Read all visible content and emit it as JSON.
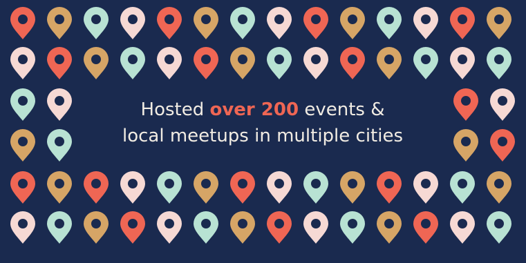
{
  "palette": {
    "background": "#1a2a4f",
    "coral": "#ef6654",
    "tan": "#d6a566",
    "mint": "#b8e2d3",
    "blush": "#f6d9d4",
    "text": "#f1ece3"
  },
  "icon": "map-pin-icon",
  "headline": {
    "prefix": "Hosted ",
    "highlight": "over 200",
    "suffix_line1": " events &",
    "line2": "local meetups in multiple cities"
  },
  "pin_rows": [
    [
      "coral",
      "tan",
      "mint",
      "blush",
      "coral",
      "tan",
      "mint",
      "blush",
      "coral",
      "tan",
      "mint",
      "blush",
      "coral",
      "tan"
    ],
    [
      "blush",
      "coral",
      "tan",
      "mint",
      "blush",
      "coral",
      "tan",
      "mint",
      "blush",
      "coral",
      "tan",
      "mint",
      "blush",
      "mint"
    ],
    [
      "mint",
      "blush",
      "coral",
      "blush"
    ],
    [
      "tan",
      "mint",
      "tan",
      "coral"
    ],
    [
      "coral",
      "tan",
      "coral",
      "blush",
      "mint",
      "tan",
      "coral",
      "blush",
      "mint",
      "tan",
      "coral",
      "blush",
      "mint",
      "tan"
    ],
    [
      "blush",
      "mint",
      "tan",
      "coral",
      "blush",
      "mint",
      "tan",
      "coral",
      "blush",
      "mint",
      "tan",
      "coral",
      "blush",
      "mint"
    ]
  ]
}
